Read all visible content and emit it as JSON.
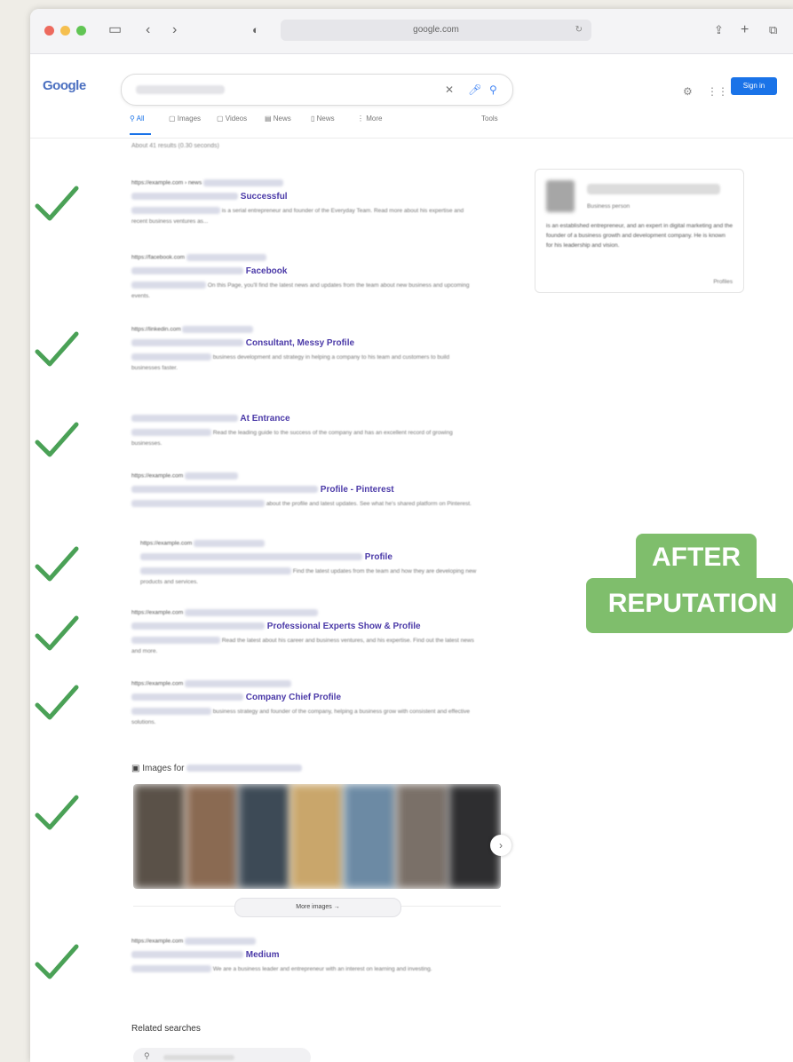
{
  "browser": {
    "url": "google.com",
    "traffic_lights": [
      "#ed6a5e",
      "#f5bf4f",
      "#61c554"
    ]
  },
  "google": {
    "logo": "Google",
    "signin_label": "Sign in",
    "tabs": [
      {
        "label": "All"
      },
      {
        "label": "Images"
      },
      {
        "label": "Videos"
      },
      {
        "label": "News"
      },
      {
        "label": "News"
      },
      {
        "label": "More"
      },
      {
        "label": "Tools"
      }
    ],
    "about": "About 41 results (0.30 seconds)"
  },
  "results": [
    {
      "url": "https://example.com › news",
      "title": "Successful",
      "snippet": "is a serial entrepreneur and founder of the Everyday Team. Read more about his expertise and recent business ventures as..."
    },
    {
      "url": "https://facebook.com",
      "title": "Facebook",
      "snippet": "On this Page, you'll find the latest news and updates from the team about new business and upcoming events."
    },
    {
      "url": "https://linkedin.com",
      "title": "Consultant, Messy Profile",
      "snippet": "business development and strategy in helping a company to his team and customers to build businesses faster."
    },
    {
      "url": "",
      "title": "At Entrance",
      "snippet": "Read the leading guide to the success of the company and has an excellent record of growing businesses."
    },
    {
      "url": "https://example.com",
      "title": "Profile - Pinterest",
      "snippet": "about the profile and latest updates. See what he's shared platform on Pinterest."
    },
    {
      "url": "https://example.com",
      "title": "Profile",
      "snippet": "Find the latest updates from the team and how they are developing new products and services."
    },
    {
      "url": "https://example.com",
      "title": "Professional Experts Show & Profile",
      "snippet": "Read the latest about his career and business ventures, and his expertise. Find out the latest news and more."
    },
    {
      "url": "https://example.com",
      "title": "Company Chief Profile",
      "snippet": "business strategy and founder of the company, helping a business grow with consistent and effective solutions."
    }
  ],
  "last_result": {
    "url": "https://example.com",
    "title": "Medium",
    "snippet": "We are a business leader and entrepreneur with an interest on learning and investing."
  },
  "knowledge_panel": {
    "subtitle": "Business person",
    "description": "is an established entrepreneur, and an expert in digital marketing and the founder of a business growth and development company. He is known for his leadership and vision.",
    "more": "Profiles"
  },
  "images": {
    "header": "Images for",
    "more_label": "More images",
    "tile_colors": [
      "#5a5148",
      "#8a6a52",
      "#3d4a56",
      "#c9a66b",
      "#6c8aa4",
      "#7a7068",
      "#2e2e30"
    ]
  },
  "related": {
    "header": "Related searches"
  },
  "badge": {
    "line1": "AFTER",
    "line2": "REPUTATION",
    "color": "#7fbe6c"
  }
}
